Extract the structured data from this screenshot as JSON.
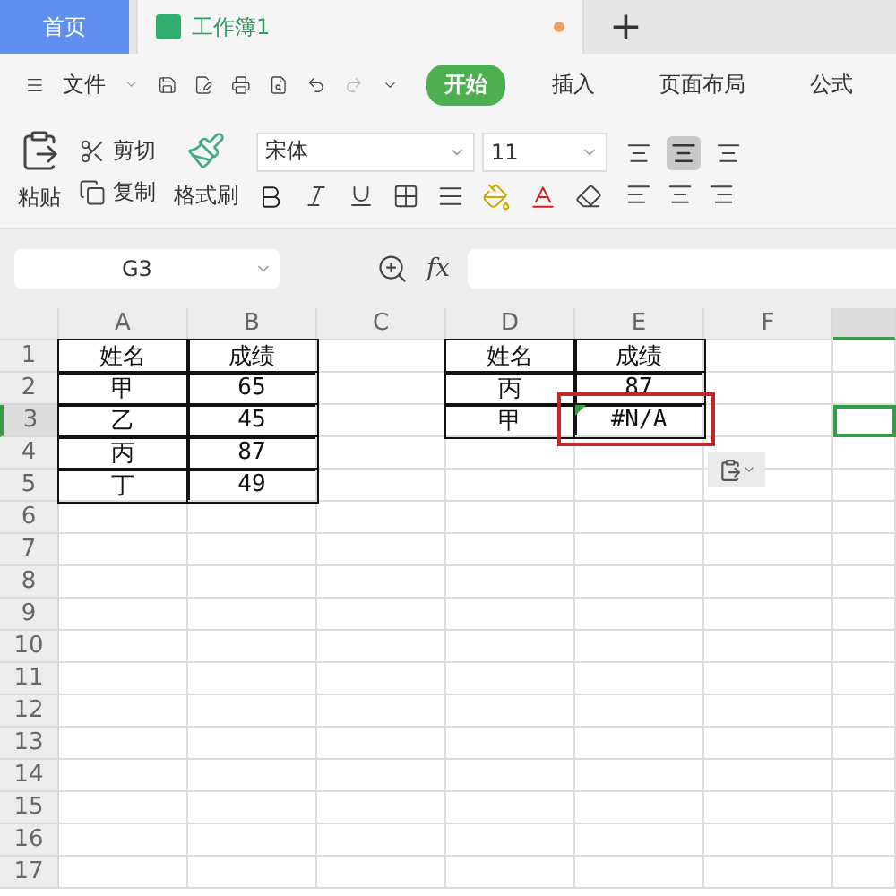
{
  "tabs": [
    {
      "label": "首页",
      "kind": "home",
      "selected": false,
      "unsaved": false
    },
    {
      "label": "工作簿1",
      "kind": "document",
      "selected": true,
      "unsaved": true
    }
  ],
  "new_tab": "+",
  "menu": {
    "file": "文件",
    "items": [
      {
        "label": "开始",
        "selected": true
      },
      {
        "label": "插入",
        "selected": false
      },
      {
        "label": "页面布局",
        "selected": false
      },
      {
        "label": "公式",
        "selected": false
      }
    ]
  },
  "ribbon": {
    "paste": "粘贴",
    "cut": "剪切",
    "copy": "复制",
    "format_painter": "格式刷",
    "font": "宋体",
    "size": "11"
  },
  "formula_bar": {
    "cell_ref": "G3",
    "fx": "fx"
  },
  "sheet": {
    "columns": [
      {
        "label": "A",
        "selected": false
      },
      {
        "label": "B",
        "selected": false
      },
      {
        "label": "C",
        "selected": false
      },
      {
        "label": "D",
        "selected": false
      },
      {
        "label": "E",
        "selected": false
      },
      {
        "label": "F",
        "selected": false
      },
      {
        "selected": true
      }
    ],
    "rows": [
      {
        "label": "1",
        "selected": false,
        "cells": [
          {
            "text": "姓名",
            "bordered": true
          },
          {
            "text": "成绩",
            "bordered": true
          },
          {
            "bordered": false
          },
          {
            "text": "姓名",
            "bordered": true
          },
          {
            "text": "成绩",
            "bordered": true
          }
        ]
      },
      {
        "label": "2",
        "selected": false,
        "cells": [
          {
            "text": "甲",
            "bordered": true
          },
          {
            "text": "65",
            "bordered": true
          },
          {
            "bordered": false
          },
          {
            "text": "丙",
            "bordered": true
          },
          {
            "text": "87",
            "bordered": true
          }
        ]
      },
      {
        "label": "3",
        "selected": true,
        "cells": [
          {
            "text": "乙",
            "bordered": true
          },
          {
            "text": "45",
            "bordered": true
          },
          {
            "bordered": false
          },
          {
            "text": "甲",
            "bordered": true
          },
          {
            "text": "#N/A",
            "bordered": true,
            "error": true,
            "highlighted": true
          },
          {
            "bordered": false
          },
          {
            "bordered": false,
            "selected": true
          }
        ]
      },
      {
        "label": "4",
        "selected": false,
        "cells": [
          {
            "text": "丙",
            "bordered": true
          },
          {
            "text": "87",
            "bordered": true
          }
        ]
      },
      {
        "label": "5",
        "selected": false,
        "cells": [
          {
            "text": "丁",
            "bordered": true
          },
          {
            "text": "49",
            "bordered": true
          }
        ]
      },
      {
        "label": "6",
        "selected": false
      },
      {
        "label": "7",
        "selected": false
      },
      {
        "label": "8",
        "selected": false
      },
      {
        "label": "9",
        "selected": false
      },
      {
        "label": "10",
        "selected": false
      },
      {
        "label": "11",
        "selected": false
      },
      {
        "label": "12",
        "selected": false
      },
      {
        "label": "13",
        "selected": false
      },
      {
        "label": "14",
        "selected": false
      },
      {
        "label": "15",
        "selected": false
      },
      {
        "label": "16",
        "selected": false
      },
      {
        "label": "17",
        "selected": false
      }
    ]
  }
}
